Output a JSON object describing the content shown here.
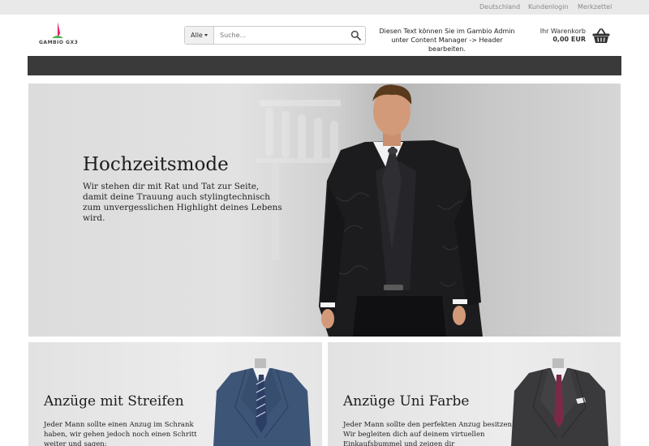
{
  "topbar": {
    "links": [
      "Deutschland",
      "Kundenlogin",
      "Merkzettel"
    ]
  },
  "logo": {
    "text": "GAMBIO GX3"
  },
  "search": {
    "category": "Alle",
    "placeholder": "Suche..."
  },
  "header_note": "Diesen Text können Sie im Gambio Admin unter Content Manager -> Header bearbeiten.",
  "cart": {
    "label": "Ihr Warenkorb",
    "amount": "0,00 EUR"
  },
  "hero": {
    "title": "Hochzeitsmode",
    "text": "Wir stehen dir mit Rat und Tat zur Seite, damit deine Trauung auch stylingtechnisch zum unvergesslichen Highlight deines Lebens wird."
  },
  "tiles": [
    {
      "title": "Anzüge mit Streifen",
      "text": "Jeder Mann sollte einen Anzug im Schrank haben, wir gehen jedoch noch einen Schritt weiter und sagen:"
    },
    {
      "title": "Anzüge Uni Farbe",
      "text": "Jeder Mann sollte den perfekten Anzug besitzen! Wir begleiten dich auf deinem virtuellen Einkaufsbummel und zeigen dir"
    }
  ],
  "colors": {
    "navbar": "#3a3a3a",
    "topbar": "#e9e9e9",
    "suit_blue": "#3d5577",
    "suit_grey": "#3a3a3c"
  },
  "icons": {
    "search": "search-icon",
    "cart": "basket-icon"
  }
}
